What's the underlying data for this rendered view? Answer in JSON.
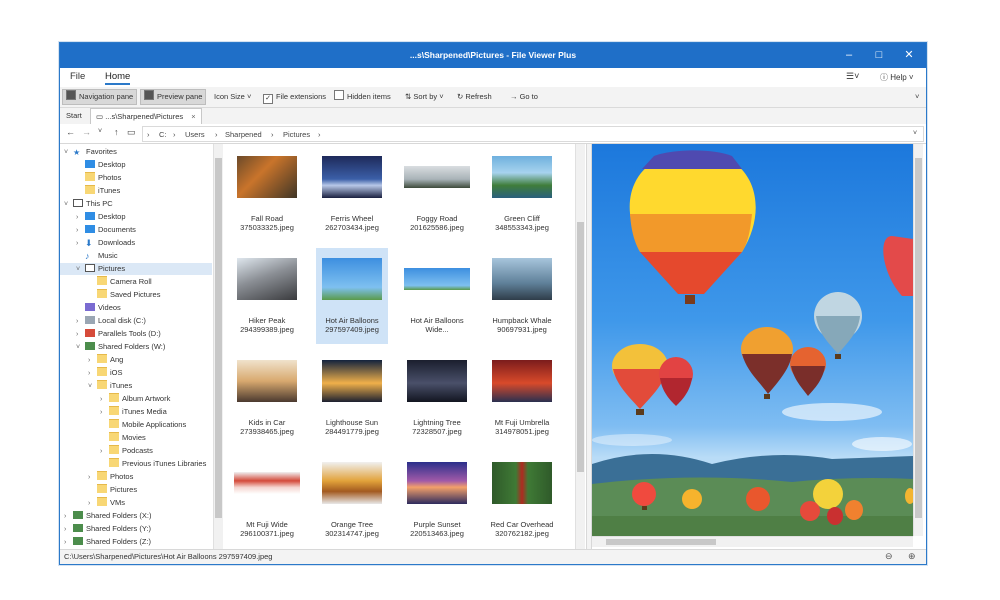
{
  "window": {
    "title": "...s\\Sharpened\\Pictures - File Viewer Plus",
    "minimize_icon": "minimize-icon",
    "maximize_icon": "maximize-icon",
    "close_icon": "close-icon",
    "accent": "#1f6fc8"
  },
  "menu": {
    "file": "File",
    "home": "Home",
    "help": "Help"
  },
  "toolbar": {
    "navigation_pane": "Navigation pane",
    "preview_pane": "Preview pane",
    "icon_size": "Icon Size",
    "file_extensions": "File extensions",
    "hidden_items": "Hidden items",
    "sort_by": "Sort by",
    "refresh": "Refresh",
    "go_to": "Go to"
  },
  "tabs": {
    "start": "Start",
    "active": "...s\\Sharpened\\Pictures"
  },
  "address": {
    "crumbs": [
      "C:",
      "Users",
      "Sharpened",
      "Pictures"
    ]
  },
  "tree": [
    {
      "label": "Favorites",
      "icon": "star-icon"
    },
    {
      "label": "Desktop",
      "icon": "desktop-icon"
    },
    {
      "label": "Photos",
      "icon": "folder-icon"
    },
    {
      "label": "iTunes",
      "icon": "folder-icon"
    },
    {
      "label": "This PC",
      "icon": "computer-icon"
    },
    {
      "label": "Desktop",
      "icon": "desktop-icon"
    },
    {
      "label": "Documents",
      "icon": "documents-icon"
    },
    {
      "label": "Downloads",
      "icon": "download-icon"
    },
    {
      "label": "Music",
      "icon": "music-icon"
    },
    {
      "label": "Pictures",
      "icon": "pictures-icon"
    },
    {
      "label": "Camera Roll",
      "icon": "folder-icon"
    },
    {
      "label": "Saved Pictures",
      "icon": "folder-icon"
    },
    {
      "label": "Videos",
      "icon": "video-icon"
    },
    {
      "label": "Local disk (C:)",
      "icon": "disk-icon"
    },
    {
      "label": "Parallels Tools (D:)",
      "icon": "parallels-icon"
    },
    {
      "label": "Shared Folders (W:)",
      "icon": "network-drive-icon"
    },
    {
      "label": "Ang",
      "icon": "folder-icon"
    },
    {
      "label": "iOS",
      "icon": "folder-icon"
    },
    {
      "label": "iTunes",
      "icon": "folder-icon"
    },
    {
      "label": "Album Artwork",
      "icon": "folder-icon"
    },
    {
      "label": "iTunes Media",
      "icon": "folder-icon"
    },
    {
      "label": "Mobile Applications",
      "icon": "folder-icon"
    },
    {
      "label": "Movies",
      "icon": "folder-icon"
    },
    {
      "label": "Podcasts",
      "icon": "folder-icon"
    },
    {
      "label": "Previous iTunes Libraries",
      "icon": "folder-icon"
    },
    {
      "label": "Photos",
      "icon": "folder-icon"
    },
    {
      "label": "Pictures",
      "icon": "folder-icon"
    },
    {
      "label": "VMs",
      "icon": "folder-icon"
    },
    {
      "label": "Shared Folders (X:)",
      "icon": "network-drive-icon"
    },
    {
      "label": "Shared Folders (Y:)",
      "icon": "network-drive-icon"
    },
    {
      "label": "Shared Folders (Z:)",
      "icon": "network-drive-icon"
    }
  ],
  "files": [
    {
      "name": "Fall Road",
      "file": "375033325.jpeg"
    },
    {
      "name": "Ferris Wheel",
      "file": "262703434.jpeg"
    },
    {
      "name": "Foggy Road",
      "file": "201625586.jpeg"
    },
    {
      "name": "Green Cliff",
      "file": "348553343.jpeg"
    },
    {
      "name": "Hiker Peak",
      "file": "294399389.jpeg"
    },
    {
      "name": "Hot Air Balloons",
      "file": "297597409.jpeg"
    },
    {
      "name": "Hot Air Balloons",
      "file": "Wide..."
    },
    {
      "name": "Humpback Whale",
      "file": "90697931.jpeg"
    },
    {
      "name": "Kids in Car",
      "file": "273938465.jpeg"
    },
    {
      "name": "Lighthouse Sun",
      "file": "284491779.jpeg"
    },
    {
      "name": "Lightning Tree",
      "file": "72328507.jpeg"
    },
    {
      "name": "Mt Fuji Umbrella",
      "file": "314978051.jpeg"
    },
    {
      "name": "Mt Fuji Wide",
      "file": "296100371.jpeg"
    },
    {
      "name": "Orange Tree",
      "file": "302314747.jpeg"
    },
    {
      "name": "Purple Sunset",
      "file": "220513463.jpeg"
    },
    {
      "name": "Red Car Overhead",
      "file": "320762182.jpeg"
    }
  ],
  "status": {
    "path": "C:\\Users\\Sharpened\\Pictures\\Hot Air Balloons 297597409.jpeg"
  }
}
